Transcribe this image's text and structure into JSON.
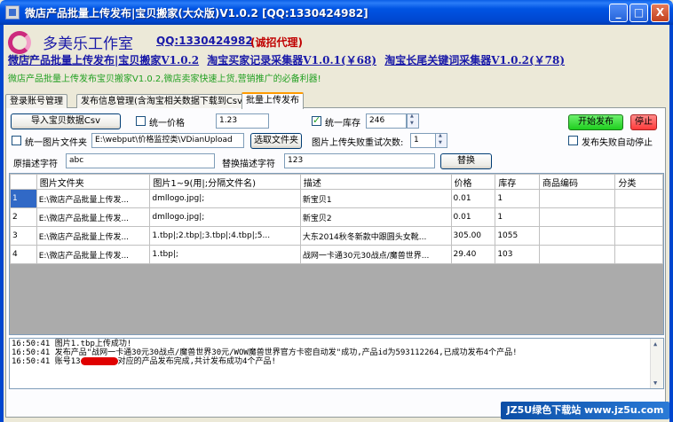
{
  "window": {
    "title": "微店产品批量上传发布|宝贝搬家(大众版)V1.0.2 [QQ:1330424982]",
    "minimize": "_",
    "maximize": "□",
    "close": "X"
  },
  "header": {
    "studio_name": "多美乐工作室",
    "logo_caption": "多美乐DML",
    "qq": "QQ:1330424982",
    "agent_note": "(诚招代理)",
    "links": [
      "微店产品批量上传发布|宝贝搬家V1.0.2",
      "淘宝买家记录采集器V1.0.1(￥68)",
      "淘宝长尾关键词采集器V1.0.2(￥78)"
    ],
    "slogan": "微店产品批量上传发布宝贝搬家V1.0.2,微店卖家快速上货,营销推广的必备利器!"
  },
  "tabs": [
    "登录账号管理",
    "发布信息管理(含淘宝相关数据下载到Csv)",
    "批量上传发布"
  ],
  "controls": {
    "import_button": "导入宝贝数据Csv",
    "unify_price_label": "统一价格",
    "unify_price_checked": false,
    "unify_price_value": "1.23",
    "unify_stock_label": "统一库存",
    "unify_stock_checked": true,
    "unify_stock_value": "246",
    "start_button": "开始发布",
    "stop_button": "停止",
    "unify_image_folder_label": "统一图片文件夹",
    "unify_image_folder_checked": false,
    "image_folder_path": "E:\\webput\\价格监控类\\VDianUpload",
    "select_folder_button": "选取文件夹",
    "retry_label": "图片上传失败重试次数:",
    "retry_value": "1",
    "auto_stop_label": "发布失败自动停止",
    "auto_stop_checked": false,
    "orig_desc_label": "原描述字符",
    "orig_desc_value": "abc",
    "replace_desc_label": "替换描述字符",
    "replace_desc_value": "123",
    "replace_button": "替换"
  },
  "table": {
    "columns": [
      "图片文件夹",
      "图片1~9(用|;分隔文件名)",
      "描述",
      "价格",
      "库存",
      "商品编码",
      "分类"
    ],
    "rows": [
      {
        "num": "1",
        "folder": "E:\\微店产品批量上传发...",
        "images": "dmllogo.jpg|;",
        "desc": "新宝贝1",
        "price": "0.01",
        "stock": "1",
        "code": "",
        "category": ""
      },
      {
        "num": "2",
        "folder": "E:\\微店产品批量上传发...",
        "images": "dmllogo.jpg|;",
        "desc": "新宝贝2",
        "price": "0.01",
        "stock": "1",
        "code": "",
        "category": ""
      },
      {
        "num": "3",
        "folder": "E:\\微店产品批量上传发...",
        "images": "1.tbp|;2.tbp|;3.tbp|;4.tbp|;5...",
        "desc": "大东2014秋冬新款中跟圆头女靴...",
        "price": "305.00",
        "stock": "1055",
        "code": "",
        "category": ""
      },
      {
        "num": "4",
        "folder": "E:\\微店产品批量上传发...",
        "images": "1.tbp|;",
        "desc": "战网一卡通30元30战点/魔兽世界...",
        "price": "29.40",
        "stock": "103",
        "code": "",
        "category": ""
      }
    ]
  },
  "log": {
    "lines": [
      {
        "pre": "16:50:41 图片1.tbp上传成功!",
        "post": ""
      },
      {
        "pre": "16:50:41 发布产品\"战网一卡通30元30战点/魔兽世界30元/WOW魔兽世界官方卡密自动发\"成功,产品id为593112264,已成功发布4个产品!",
        "post": ""
      },
      {
        "pre": "16:50:41 账号13",
        "post": "对应的产品发布完成,共计发布成功4个产品!"
      }
    ]
  },
  "watermark": "JZ5U绿色下载站 www.jz5u.com"
}
